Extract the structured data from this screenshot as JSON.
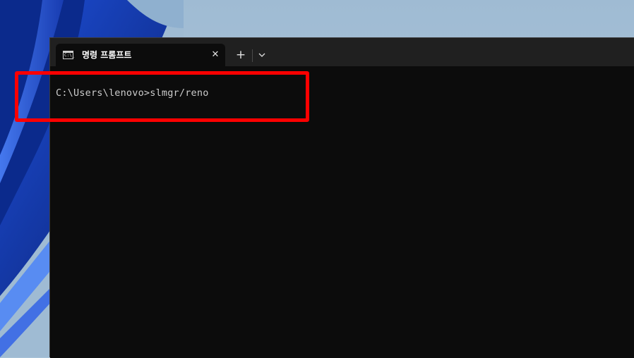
{
  "window": {
    "tab_title": "명령 프롬프트",
    "tab_icon": "command-prompt-icon",
    "tab_icon_glyph": "C:\\_",
    "close_icon": "close-icon",
    "new_tab_icon": "plus-icon",
    "dropdown_icon": "chevron-down-icon"
  },
  "terminal": {
    "prompt_line": "C:\\Users\\lenovo>slmgr/reno"
  },
  "colors": {
    "terminal_bg": "#0c0c0c",
    "tabbar_bg": "#202020",
    "highlight": "#ff0000",
    "text": "#cccccc"
  }
}
